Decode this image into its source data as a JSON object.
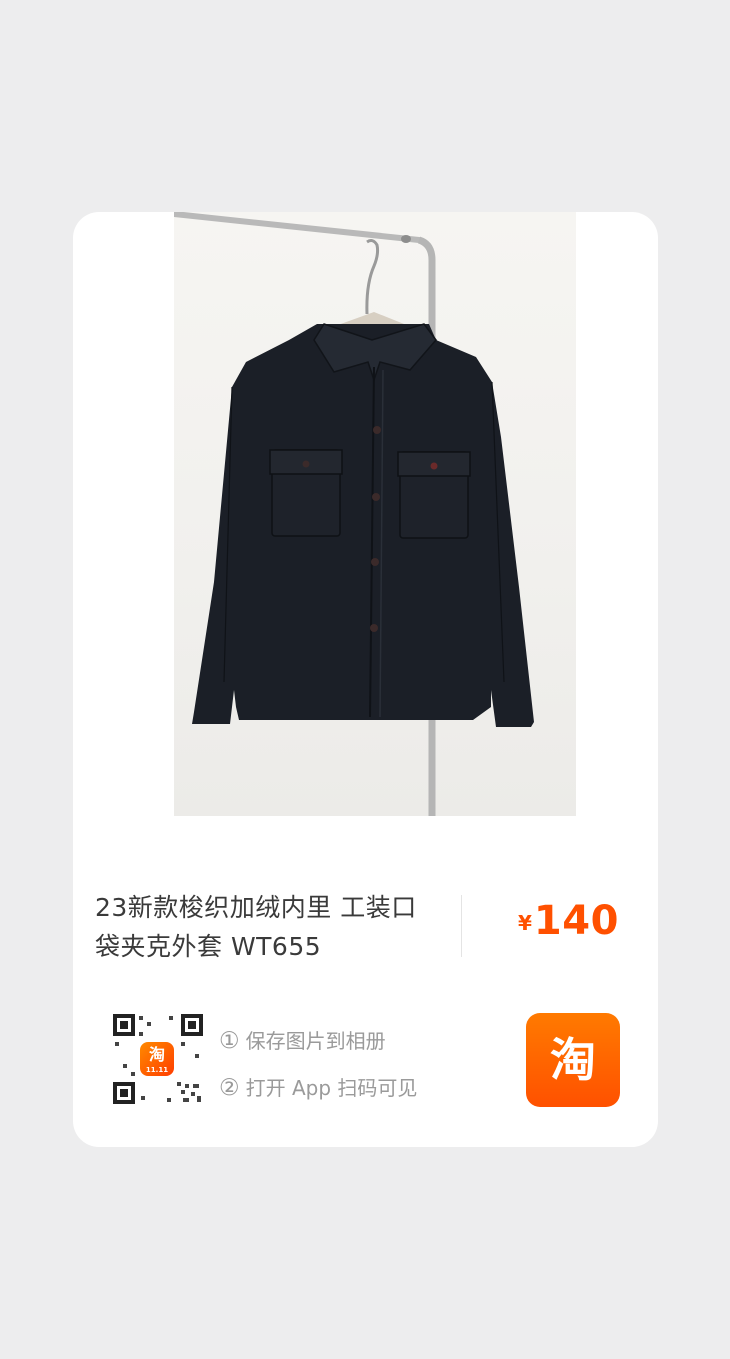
{
  "product": {
    "title": "23新款梭织加绒内里 工装口袋夹克外套 WT655",
    "currency_symbol": "¥",
    "price": "140"
  },
  "instructions": [
    {
      "num": "①",
      "text": "保存图片到相册"
    },
    {
      "num": "②",
      "text": "打开 App 扫码可见"
    }
  ],
  "app": {
    "logo_char": "淘",
    "mini_logo_char": "淘",
    "mini_logo_tag": "11.11"
  },
  "colors": {
    "accent": "#ff5000",
    "background": "#ededee",
    "card": "#ffffff"
  }
}
